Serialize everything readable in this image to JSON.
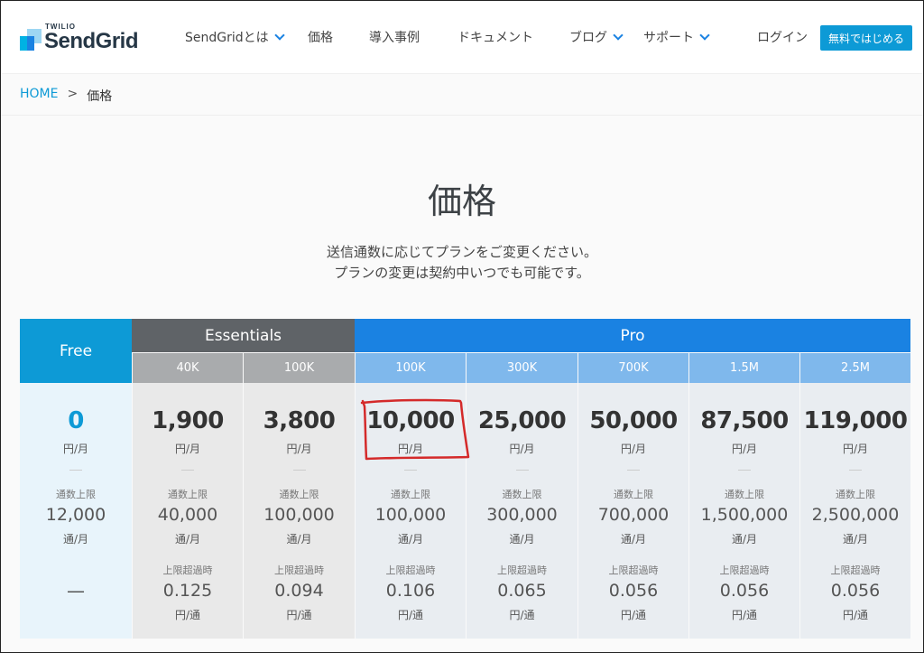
{
  "header": {
    "brand_small": "TWILIO",
    "brand": "SendGrid",
    "nav": [
      {
        "label": "SendGridとは",
        "dropdown": true
      },
      {
        "label": "価格",
        "dropdown": false
      },
      {
        "label": "導入事例",
        "dropdown": false
      },
      {
        "label": "ドキュメント",
        "dropdown": false
      },
      {
        "label": "ブログ",
        "dropdown": true
      },
      {
        "label": "サポート",
        "dropdown": true
      },
      {
        "label": "ログイン",
        "dropdown": false
      }
    ],
    "cta": "無料ではじめる"
  },
  "breadcrumb": {
    "home": "HOME",
    "sep": ">",
    "current": "価格"
  },
  "page": {
    "title": "価格",
    "desc1": "送信通数に応じてプランをご変更ください。",
    "desc2": "プランの変更は契約中いつでも可能です。"
  },
  "table": {
    "labels": {
      "limit": "通数上限",
      "over": "上限超過時",
      "price_unit": "円/月",
      "limit_unit": "通/月",
      "over_unit": "円/通"
    },
    "groups": {
      "free": "Free",
      "essentials": "Essentials",
      "pro": "Pro"
    },
    "plans": [
      {
        "tier": "",
        "price": "0",
        "limit": "12,000",
        "over": "—"
      },
      {
        "tier": "40K",
        "price": "1,900",
        "limit": "40,000",
        "over": "0.125"
      },
      {
        "tier": "100K",
        "price": "3,800",
        "limit": "100,000",
        "over": "0.094"
      },
      {
        "tier": "100K",
        "price": "10,000",
        "limit": "100,000",
        "over": "0.106"
      },
      {
        "tier": "300K",
        "price": "25,000",
        "limit": "300,000",
        "over": "0.065"
      },
      {
        "tier": "700K",
        "price": "50,000",
        "limit": "700,000",
        "over": "0.056"
      },
      {
        "tier": "1.5M",
        "price": "87,500",
        "limit": "1,500,000",
        "over": "0.056"
      },
      {
        "tier": "2.5M",
        "price": "119,000",
        "limit": "2,500,000",
        "over": "0.056"
      }
    ]
  },
  "colors": {
    "accent": "#0d9ad6",
    "pro_blue": "#1a82e2",
    "pro_sub": "#7fb8ec",
    "essentials_dark": "#5f6367",
    "essentials_sub": "#a9abad",
    "free_bg": "#e8f4fb",
    "essentials_bg": "#e9e9e9",
    "pro_bg": "#e9edf1",
    "annotation_red": "#d42a2a"
  }
}
